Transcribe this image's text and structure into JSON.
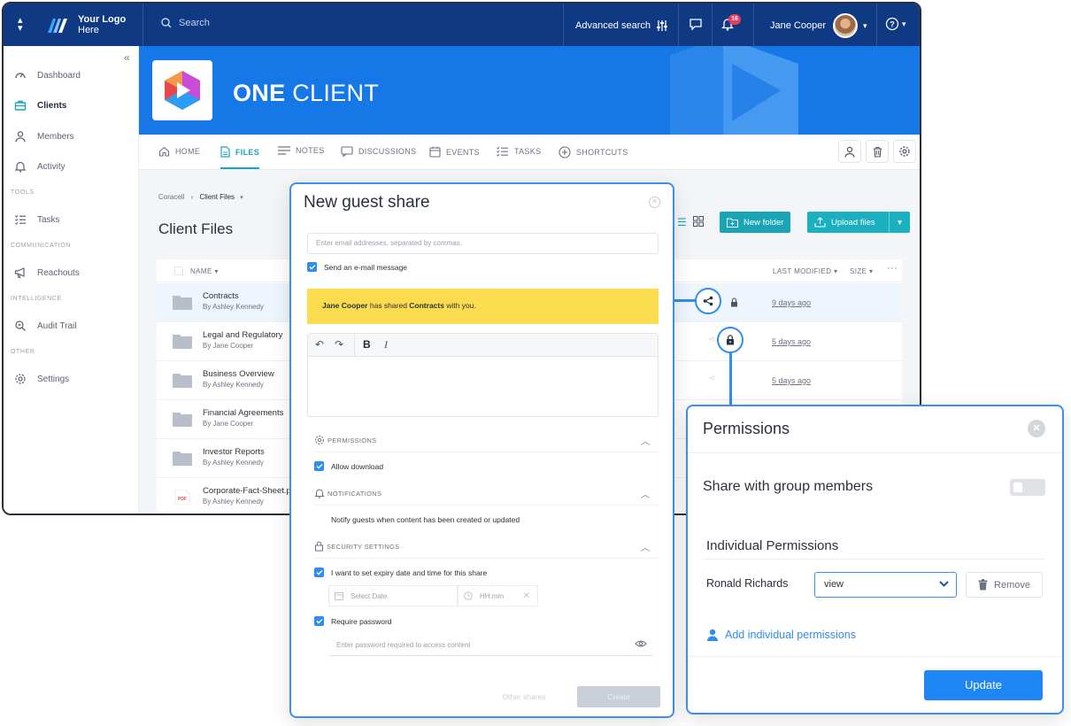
{
  "topbar": {
    "logo_line1": "Your Logo",
    "logo_line2": "Here",
    "search_placeholder": "Search",
    "advanced_search": "Advanced search",
    "notification_count": "16",
    "user_name": "Jane Cooper"
  },
  "sidebar": {
    "items": [
      {
        "label": "Dashboard",
        "icon": "gauge-icon"
      },
      {
        "label": "Clients",
        "icon": "briefcase-icon"
      },
      {
        "label": "Members",
        "icon": "person-icon"
      },
      {
        "label": "Activity",
        "icon": "bell-icon"
      },
      {
        "label": "Tasks",
        "icon": "checklist-icon"
      },
      {
        "label": "Reachouts",
        "icon": "megaphone-icon"
      },
      {
        "label": "Audit Trail",
        "icon": "search-sparkle-icon"
      },
      {
        "label": "Settings",
        "icon": "gear-icon"
      }
    ],
    "sections": [
      "TOOLS",
      "COMMUNICATION",
      "INTELLIGENCE",
      "OTHER"
    ]
  },
  "banner": {
    "title_bold": "ONE",
    "title_rest": " CLIENT"
  },
  "tabs": [
    "HOME",
    "FILES",
    "NOTES",
    "DISCUSSIONS",
    "EVENTS",
    "TASKS",
    "SHORTCUTS"
  ],
  "content": {
    "breadcrumb_root": "Coracell",
    "breadcrumb_current": "Client Files",
    "page_title": "Client Files",
    "new_folder": "New folder",
    "upload_files": "Upload files",
    "col_name": "NAME",
    "col_modified": "LAST MODIFIED",
    "col_size": "SIZE",
    "rows": [
      {
        "name": "Contracts",
        "by": "By Ashley Kennedy",
        "date": "9 days ago"
      },
      {
        "name": "Legal and Regulatory",
        "by": "By Jane Cooper",
        "date": "5 days ago"
      },
      {
        "name": "Business Overview",
        "by": "By Ashley Kennedy",
        "date": "5 days ago"
      },
      {
        "name": "Financial Agreements",
        "by": "By Jane Cooper",
        "date": ""
      },
      {
        "name": "Investor Reports",
        "by": "By Ashley Kennedy",
        "date": ""
      },
      {
        "name": "Corporate-Fact-Sheet.p",
        "by": "By Ashley Kennedy",
        "date": ""
      }
    ]
  },
  "guest_share": {
    "title": "New guest share",
    "email_placeholder": "Enter email addresses, separated by commas.",
    "send_email": "Send an e-mail message",
    "preview_user": "Jane Cooper",
    "preview_mid": " has shared ",
    "preview_item": "Contracts",
    "preview_end": " with you.",
    "permissions_header": "PERMISSIONS",
    "allow_download": "Allow download",
    "notifications_header": "NOTIFICATIONS",
    "notify_guests": "Notify guests when content has been created or updated",
    "security_header": "SECURITY SETTINGS",
    "expiry": "I want to set expiry date and time for this share",
    "date_placeholder": "Select Date",
    "time_placeholder": "HH:mm",
    "require_password": "Require password",
    "password_placeholder": "Enter password required to access content",
    "other_shares": "Other shares",
    "create": "Create"
  },
  "permissions_panel": {
    "title": "Permissions",
    "share_group": "Share with group members",
    "individual": "Individual Permissions",
    "person": "Ronald Richards",
    "selected_permission": "view",
    "remove": "Remove",
    "add_individual": "Add individual permissions",
    "update": "Update"
  },
  "colors": {
    "topbar": "#0f3a83",
    "banner": "#1677e6",
    "accent_teal": "#1aa5c2",
    "callout_blue": "#2f8cf0",
    "preview_yellow": "#fadc4e"
  }
}
